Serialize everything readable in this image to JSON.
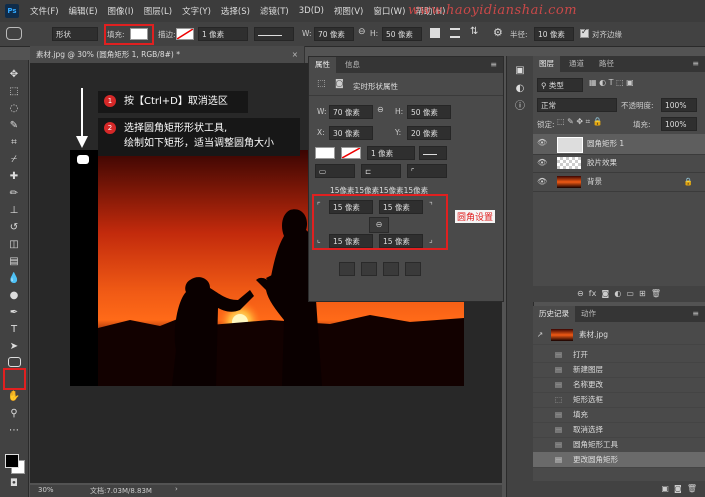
{
  "menu": {
    "logo": "Ps",
    "items": [
      "文件(F)",
      "编辑(E)",
      "图像(I)",
      "图层(L)",
      "文字(Y)",
      "选择(S)",
      "滤镜(T)",
      "3D(D)",
      "视图(V)",
      "窗口(W)",
      "帮助(H)"
    ],
    "watermark": "www.haoyidianshai.com"
  },
  "options": {
    "shape_mode": "形状",
    "fill_label": "填充:",
    "stroke_label": "描边:",
    "stroke_width": "1 像素",
    "w_label": "W:",
    "w_value": "70 像素",
    "h_label": "H:",
    "h_value": "50 像素",
    "radius_label": "半径:",
    "radius_value": "10 像素",
    "align_edges": "对齐边缘"
  },
  "document": {
    "tab_title": "素材.jpg @ 30% (圆角矩形 1, RGB/8#) *",
    "zoom": "30%",
    "doc_info": "文档:7.03M/8.83M"
  },
  "annotation": {
    "step1_num": "1",
    "step1_text": "按【Ctrl+D】取消选区",
    "step2_num": "2",
    "step2_line1": "选择圆角矩形形状工具,",
    "step2_line2": "绘制如下矩形，适当调整圆角大小",
    "corner_label": "圆角设置"
  },
  "properties": {
    "tab_properties": "属性",
    "tab_info": "信息",
    "subtitle": "实时形状属性",
    "w_label": "W:",
    "w_value": "70 像素",
    "h_label": "H:",
    "h_value": "50 像素",
    "x_label": "X:",
    "x_value": "30 像素",
    "y_label": "Y:",
    "y_value": "20 像素",
    "stroke_width": "1 像素",
    "corner_summary": "15像素15像素15像素15像素",
    "corner_tl": "15 像素",
    "corner_tr": "15 像素",
    "corner_bl": "15 像素",
    "corner_br": "15 像素"
  },
  "layers": {
    "tabs": [
      "图层",
      "通道",
      "路径"
    ],
    "filter_kind": "类型",
    "blend_mode": "正常",
    "opacity_label": "不透明度:",
    "opacity_value": "100%",
    "lock_label": "锁定:",
    "fill_label": "填充:",
    "fill_value": "100%",
    "items": [
      {
        "name": "圆角矩形 1",
        "type": "shape"
      },
      {
        "name": "胶片效果",
        "type": "transparent"
      },
      {
        "name": "背景",
        "type": "image"
      }
    ]
  },
  "history": {
    "tabs": [
      "历史记录",
      "动作"
    ],
    "snapshot": "素材.jpg",
    "items": [
      "打开",
      "新建图层",
      "名称更改",
      "矩形选框",
      "填充",
      "取消选择",
      "圆角矩形工具",
      "更改圆角矩形"
    ]
  },
  "colors": {
    "highlight_red": "#e02020",
    "canvas_bg": "#282828"
  }
}
